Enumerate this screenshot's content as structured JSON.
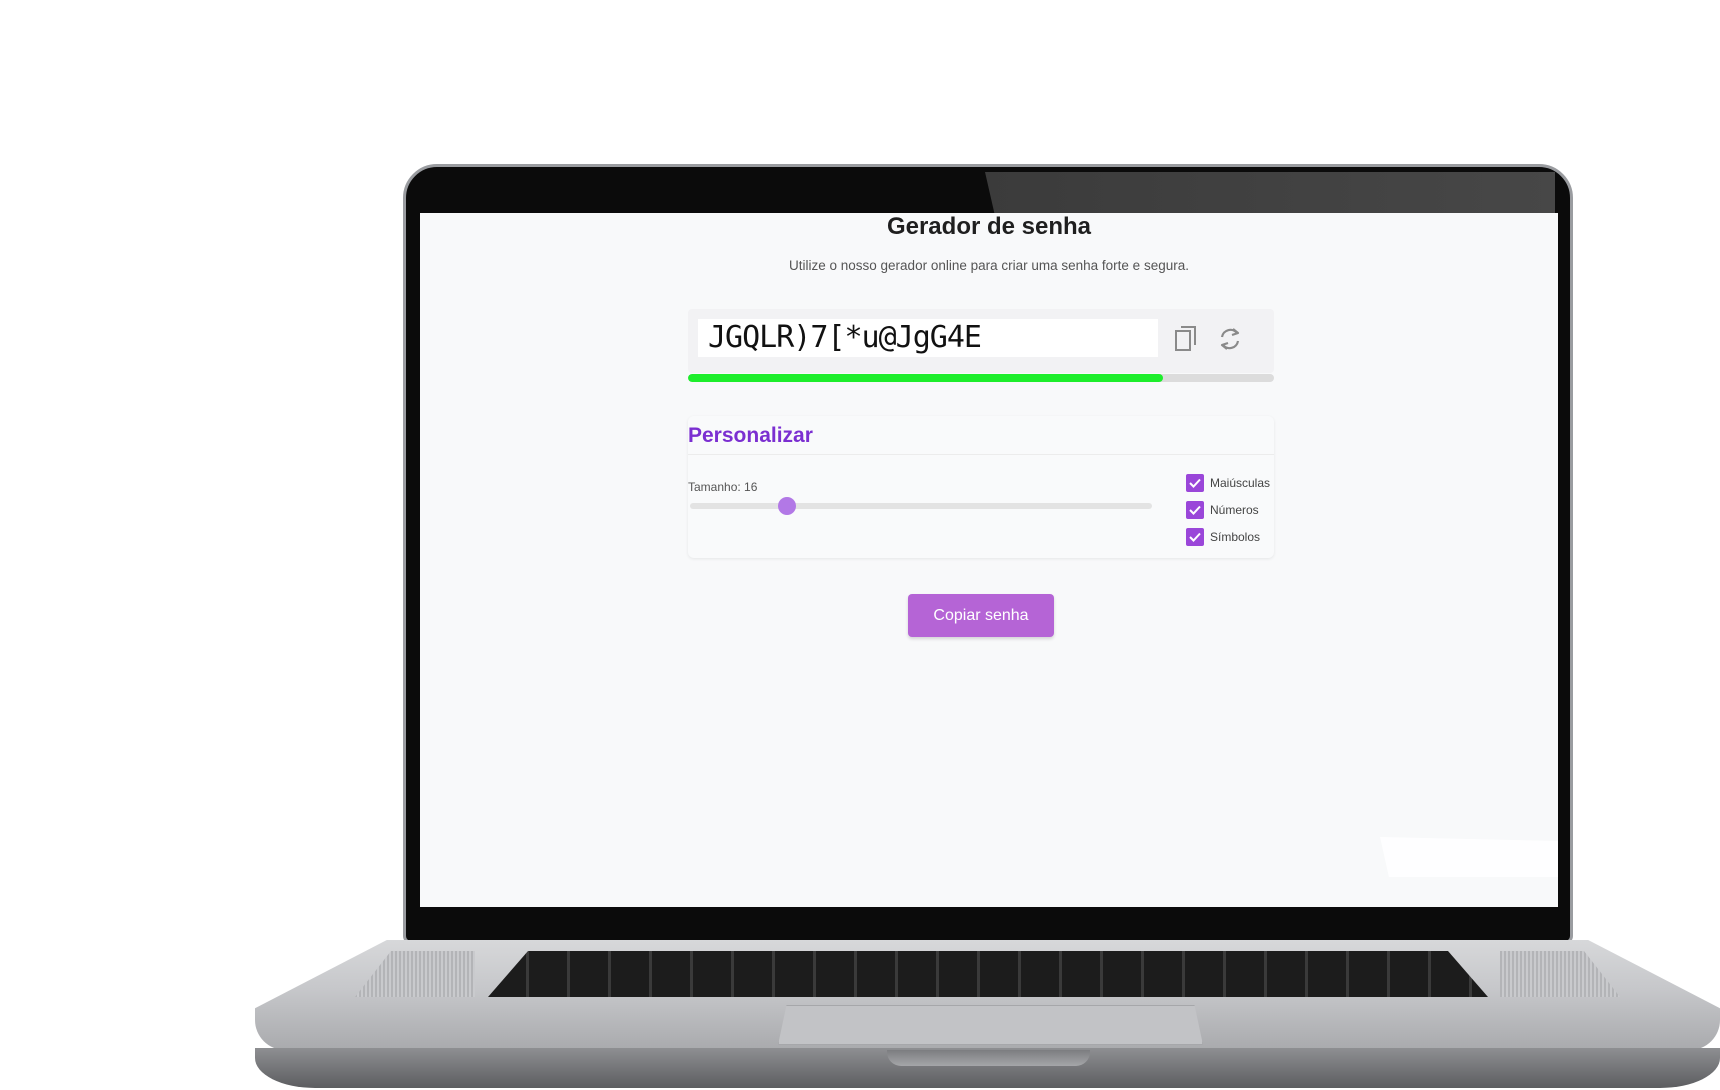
{
  "app": {
    "title": "Gerador de senha",
    "subtitle": "Utilize o nosso gerador online para criar uma senha forte e segura."
  },
  "password": {
    "value": "JGQLR)7[*u@JgG4E",
    "strength_fraction": 0.81,
    "strength_color": "#1dee2b",
    "copy_icon": "copy-icon",
    "refresh_icon": "refresh-icon"
  },
  "customize": {
    "title": "Personalizar",
    "size_label": "Tamanho: 16",
    "length": 16,
    "slider_fraction": 0.21,
    "options": [
      {
        "label": "Maiúsculas",
        "checked": true
      },
      {
        "label": "Números",
        "checked": true
      },
      {
        "label": "Símbolos",
        "checked": true
      }
    ]
  },
  "actions": {
    "copy_button_label": "Copiar senha"
  },
  "colors": {
    "accent": "#9a46d9",
    "button": "#b564d6",
    "title_purple": "#7b2fd1"
  }
}
